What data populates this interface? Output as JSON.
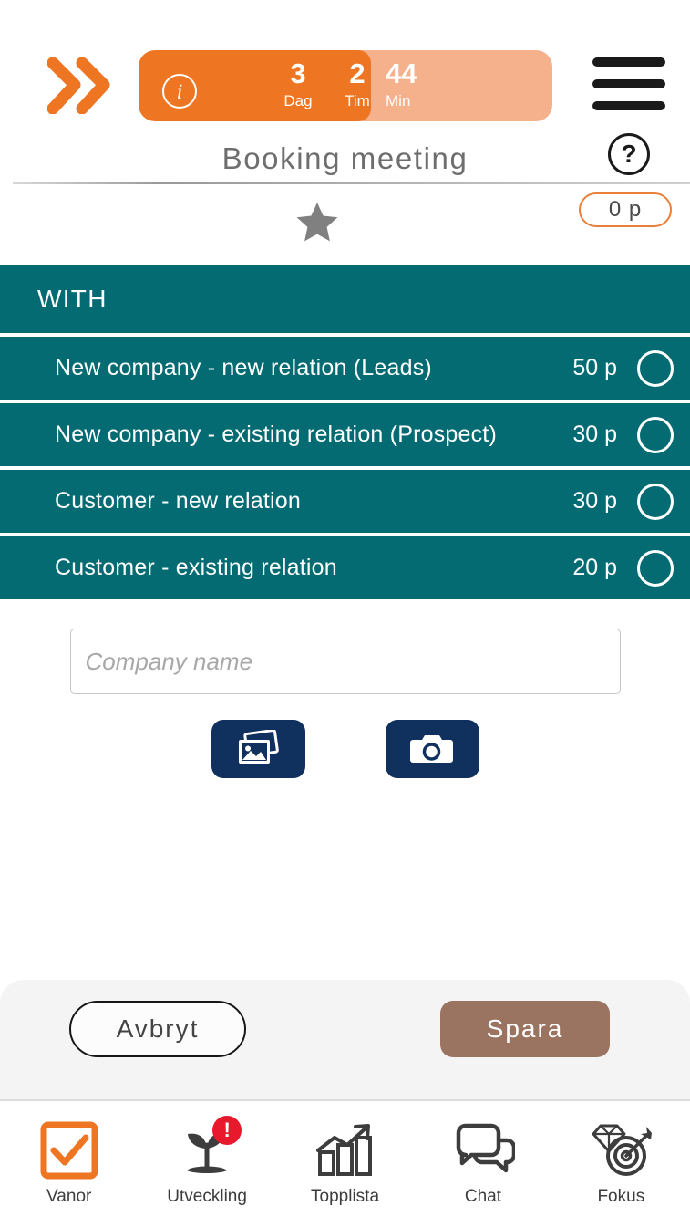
{
  "header": {
    "logo_icon": "double-chevron-right-icon",
    "menu_icon": "hamburger-menu-icon",
    "help_icon": "question-mark-circle-icon",
    "info_icon": "info-circle-icon",
    "title": "Booking meeting",
    "timer": {
      "units": [
        {
          "value": "3",
          "label": "Dag"
        },
        {
          "value": "2",
          "label": "Tim"
        },
        {
          "value": "44",
          "label": "Min"
        }
      ],
      "fill_color": "#EE7623",
      "track_color": "#F5B08C"
    }
  },
  "subbar": {
    "star_icon": "star-icon",
    "points_badge": "0 p",
    "badge_border_color": "#E8803A"
  },
  "list": {
    "header": "WITH",
    "background_color": "#046B73",
    "rows": [
      {
        "label": "New company - new relation (Leads)",
        "points": "50 p",
        "selected": false
      },
      {
        "label": "New company - existing relation (Prospect)",
        "points": "30 p",
        "selected": false
      },
      {
        "label": "Customer - new relation",
        "points": "30 p",
        "selected": false
      },
      {
        "label": "Customer - existing relation",
        "points": "20 p",
        "selected": false
      }
    ]
  },
  "form": {
    "company_placeholder": "Company name",
    "company_value": "",
    "gallery_icon": "photo-gallery-icon",
    "camera_icon": "camera-icon",
    "media_button_color": "#10305E"
  },
  "actions": {
    "cancel_label": "Avbryt",
    "save_label": "Spara",
    "save_color": "#9A7361"
  },
  "bottom_nav": {
    "items": [
      {
        "label": "Vanor",
        "icon": "checkbox-check-icon",
        "active": true,
        "badge": ""
      },
      {
        "label": "Utveckling",
        "icon": "sprout-plant-icon",
        "active": false,
        "badge": "!"
      },
      {
        "label": "Topplista",
        "icon": "bar-chart-arrow-icon",
        "active": false,
        "badge": ""
      },
      {
        "label": "Chat",
        "icon": "chat-bubbles-icon",
        "active": false,
        "badge": ""
      },
      {
        "label": "Fokus",
        "icon": "diamond-target-icon",
        "active": false,
        "badge": ""
      }
    ],
    "active_color": "#EE7623",
    "badge_color": "#E8192C"
  }
}
